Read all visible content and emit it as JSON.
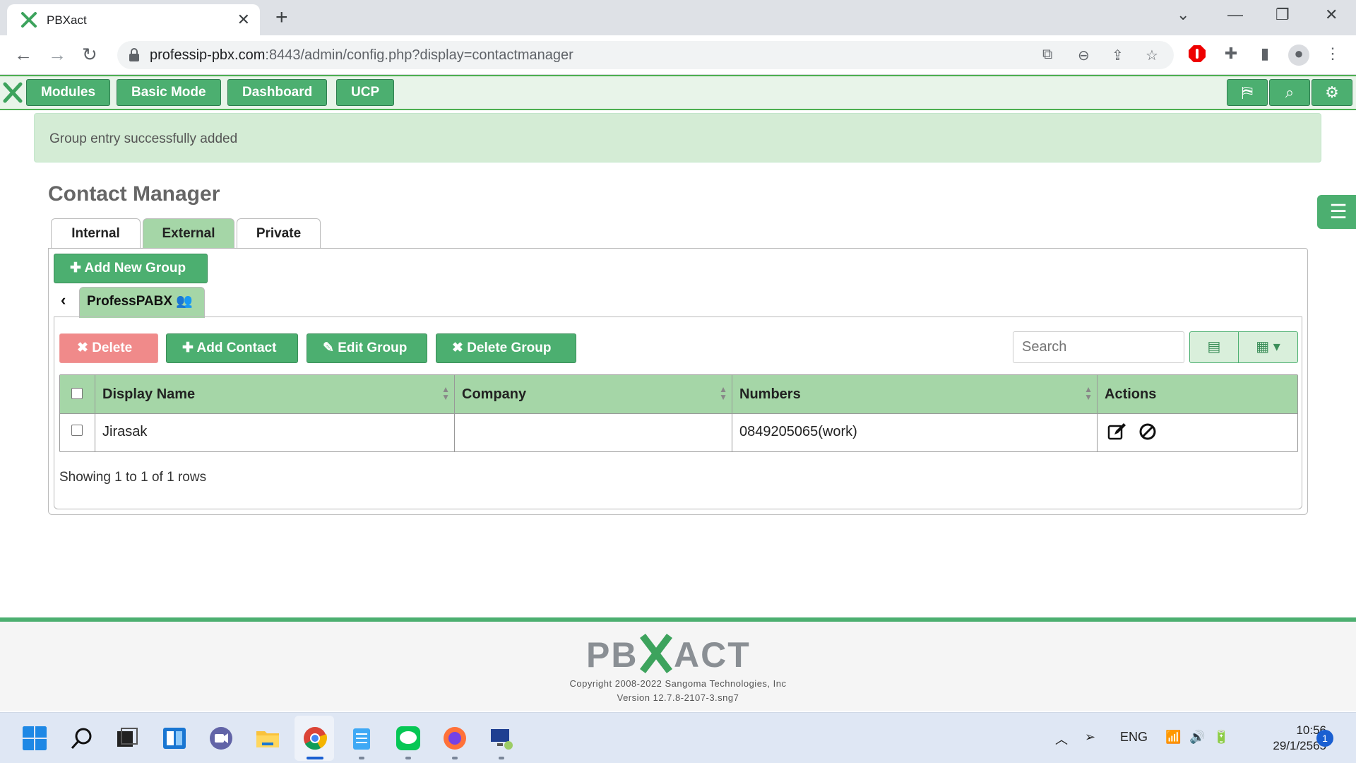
{
  "browser": {
    "tab_title": "PBXact",
    "url_host": "professip-pbx.com",
    "url_rest": ":8443/admin/config.php?display=contactmanager"
  },
  "pbx_nav": {
    "buttons": [
      "Modules",
      "Basic Mode",
      "Dashboard",
      "UCP"
    ],
    "icons": [
      "translate-icon",
      "search-icon",
      "gear-icon"
    ]
  },
  "alert": {
    "message": "Group entry successfully added"
  },
  "page": {
    "title": "Contact Manager",
    "tabs": [
      "Internal",
      "External",
      "Private"
    ],
    "active_tab": "External",
    "add_group_label": "Add New Group",
    "group_name": "ProfessPABX"
  },
  "toolbar": {
    "delete_label": "Delete",
    "add_contact_label": "Add Contact",
    "edit_group_label": "Edit Group",
    "delete_group_label": "Delete Group",
    "search_placeholder": "Search"
  },
  "table": {
    "columns": [
      "Display Name",
      "Company",
      "Numbers",
      "Actions"
    ],
    "rows": [
      {
        "display_name": "Jirasak",
        "company": "",
        "numbers": "0849205065(work)"
      }
    ],
    "footer": "Showing 1 to 1 of 1 rows"
  },
  "footer": {
    "brand": "PBXACT",
    "copyright": "Copyright 2008-2022 Sangoma Technologies, Inc",
    "version": "Version 12.7.8-2107-3.sng7"
  },
  "taskbar": {
    "lang": "ENG",
    "time": "10:56",
    "date": "29/1/2565",
    "notifications": "1"
  },
  "colors": {
    "accent_green": "#4caf70",
    "header_green": "#a5d6a7",
    "alert_bg": "#d4ecd5",
    "delete_red": "#f08a8a"
  }
}
